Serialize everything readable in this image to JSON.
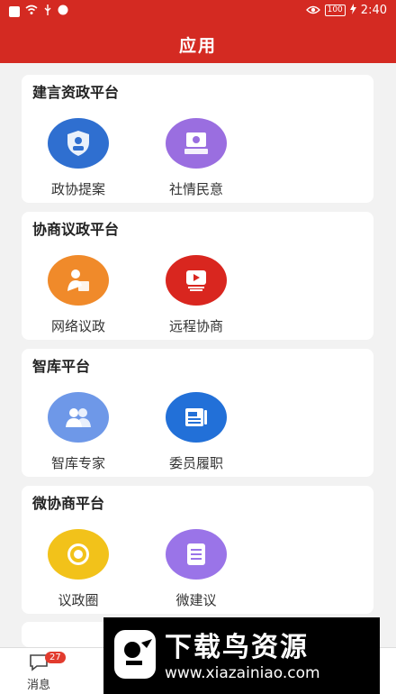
{
  "status_bar": {
    "battery": "100",
    "time": "2:40"
  },
  "header": {
    "title": "应用"
  },
  "sections": [
    {
      "title": "建言资政平台",
      "apps": [
        {
          "label": "政协提案",
          "icon": "shield-user-icon",
          "color": "#2f6fd0"
        },
        {
          "label": "社情民意",
          "icon": "monitor-inbox-icon",
          "color": "#9a6ee0"
        }
      ]
    },
    {
      "title": "协商议政平台",
      "apps": [
        {
          "label": "网络议政",
          "icon": "person-writing-icon",
          "color": "#f08a2a"
        },
        {
          "label": "远程协商",
          "icon": "video-play-icon",
          "color": "#d9261f"
        }
      ]
    },
    {
      "title": "智库平台",
      "apps": [
        {
          "label": "智库专家",
          "icon": "group-users-icon",
          "color": "#6e98e8"
        },
        {
          "label": "委员履职",
          "icon": "newspaper-pen-icon",
          "color": "#2270d8"
        }
      ]
    },
    {
      "title": "微协商平台",
      "apps": [
        {
          "label": "议政圈",
          "icon": "circle-ring-icon",
          "color": "#f2c21a"
        },
        {
          "label": "微建议",
          "icon": "list-doc-icon",
          "color": "#9a74e8"
        }
      ]
    }
  ],
  "bottom_nav": {
    "messages_label": "消息",
    "messages_badge": "27"
  },
  "watermark": {
    "title": "下载鸟资源",
    "url": "www.xiazainiao.com"
  }
}
